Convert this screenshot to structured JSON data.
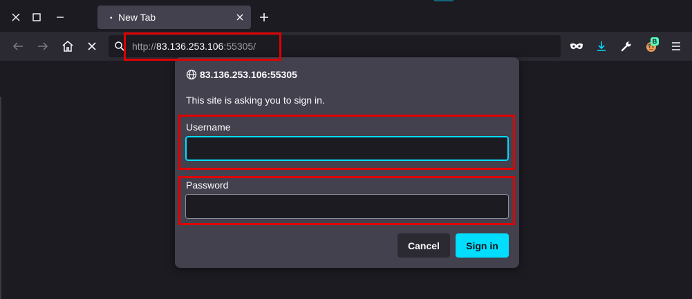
{
  "tab": {
    "title": "New Tab",
    "indicator": "•"
  },
  "urlbar": {
    "scheme": "http://",
    "host": "83.136.253.106",
    "port_path": ":55305/"
  },
  "dialog": {
    "host": "83.136.253.106:55305",
    "message": "This site is asking you to sign in.",
    "username_label": "Username",
    "username_value": "",
    "password_label": "Password",
    "password_value": "",
    "cancel_label": "Cancel",
    "signin_label": "Sign in"
  },
  "extensions": {
    "badge": "B"
  },
  "colors": {
    "accent": "#00ddff",
    "highlight": "#e00000",
    "dialog_bg": "#42414d",
    "toolbar_bg": "#2b2a33"
  },
  "icons": [
    "close-window-icon",
    "maximize-icon",
    "minimize-icon",
    "tab-close-icon",
    "new-tab-icon",
    "back-icon",
    "forward-icon",
    "home-icon",
    "stop-icon",
    "search-icon",
    "private-mask-icon",
    "download-icon",
    "wrench-icon",
    "extension-avatar-icon",
    "menu-icon",
    "globe-icon"
  ]
}
